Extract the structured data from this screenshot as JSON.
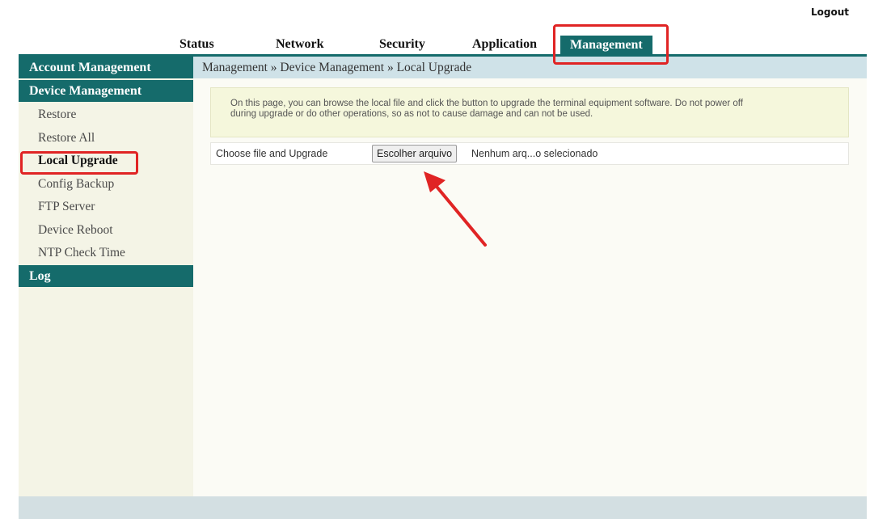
{
  "header": {
    "logout": "Logout"
  },
  "nav": {
    "tabs": [
      {
        "label": "Status"
      },
      {
        "label": "Network"
      },
      {
        "label": "Security"
      },
      {
        "label": "Application"
      },
      {
        "label": "Management",
        "active": true
      }
    ]
  },
  "sidebar": {
    "sections": [
      {
        "title": "Account Management"
      },
      {
        "title": "Device Management",
        "items": [
          {
            "label": "Restore"
          },
          {
            "label": "Restore All"
          },
          {
            "label": "Local Upgrade",
            "active": true
          },
          {
            "label": "Config Backup"
          },
          {
            "label": "FTP Server"
          },
          {
            "label": "Device Reboot"
          },
          {
            "label": "NTP Check Time"
          }
        ]
      },
      {
        "title": "Log"
      }
    ]
  },
  "main": {
    "breadcrumb": "Management » Device Management » Local Upgrade",
    "notice_line1": "On this page, you can browse the local file and click the button to upgrade the terminal equipment software. Do not power off",
    "notice_line2": "during upgrade or do other operations, so as not to cause damage and can not be used.",
    "upgrade_label": "Choose file and Upgrade",
    "file_button": "Escolher arquivo",
    "file_status": "Nenhum arq...o selecionado"
  },
  "colors": {
    "accent": "#156b6b",
    "breadcrumb_bg": "#cfe2e8",
    "sidebar_bg": "#f4f4e6",
    "notice_bg": "#f5f7dc",
    "highlight": "#e02424"
  }
}
